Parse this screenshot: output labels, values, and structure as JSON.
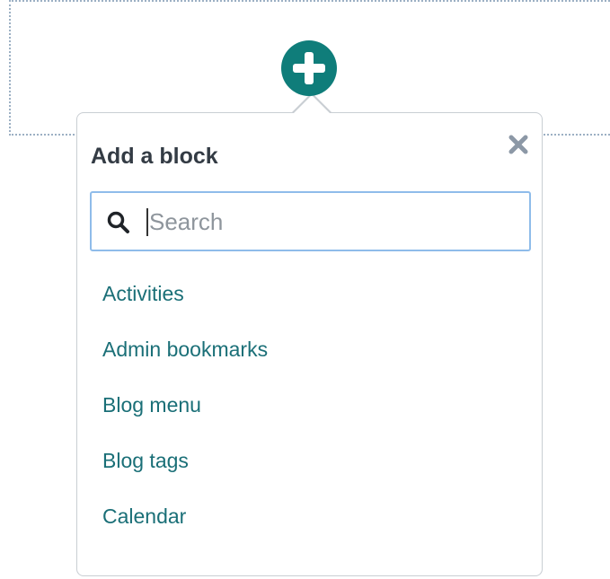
{
  "add_block_button": {
    "icon": "plus-circle-icon",
    "color": "#0f7d7a"
  },
  "popover": {
    "title": "Add a block",
    "close_icon": "close-icon",
    "search": {
      "placeholder": "Search",
      "value": "",
      "icon": "search-icon"
    },
    "items": [
      {
        "label": "Activities"
      },
      {
        "label": "Admin bookmarks"
      },
      {
        "label": "Blog menu"
      },
      {
        "label": "Blog tags"
      },
      {
        "label": "Calendar"
      }
    ]
  },
  "colors": {
    "link": "#1a6f77",
    "focus_border": "#8fbcea",
    "title": "#333b44"
  }
}
